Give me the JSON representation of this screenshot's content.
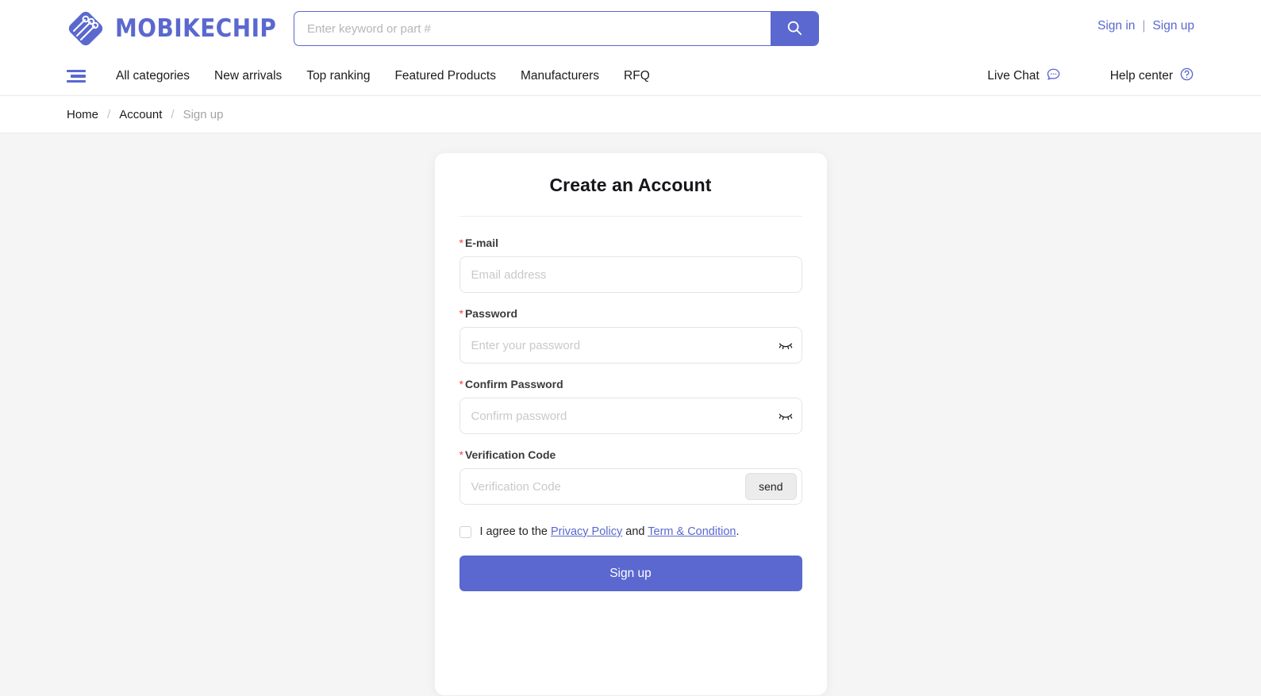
{
  "header": {
    "brand_name": "MOBIKECHIP",
    "brand_icon": "circuit-chip-logo-icon",
    "brand_color": "#5a68cf",
    "search": {
      "placeholder": "Enter keyword or part #",
      "value": "",
      "button_icon": "search-icon"
    },
    "account": {
      "sign_in": "Sign in",
      "separator": "|",
      "sign_up": "Sign up"
    }
  },
  "nav": {
    "menu_icon": "hamburger-menu-icon",
    "links": [
      {
        "label": "All categories"
      },
      {
        "label": "New arrivals"
      },
      {
        "label": "Top ranking"
      },
      {
        "label": "Featured Products"
      },
      {
        "label": "Manufacturers"
      },
      {
        "label": "RFQ"
      }
    ],
    "live_chat": {
      "label": "Live Chat",
      "icon": "chat-bubble-icon"
    },
    "help_center": {
      "label": "Help center",
      "icon": "question-circle-icon"
    }
  },
  "breadcrumb": {
    "home": "Home",
    "sep1": "/",
    "account": "Account",
    "sep2": "/",
    "current": "Sign up"
  },
  "card": {
    "title": "Create an Account",
    "fields": {
      "email": {
        "required_mark": "*",
        "label": "E-mail",
        "placeholder": "Email address",
        "value": ""
      },
      "password": {
        "required_mark": "*",
        "label": "Password",
        "placeholder": "Enter your password",
        "value": "",
        "toggle_icon": "eye-closed-icon"
      },
      "confirm_password": {
        "required_mark": "*",
        "label": "Confirm Password",
        "placeholder": "Confirm password",
        "value": "",
        "toggle_icon": "eye-closed-icon"
      },
      "verification_code": {
        "required_mark": "*",
        "label": "Verification Code",
        "placeholder": "Verification Code",
        "value": "",
        "send_label": "send"
      }
    },
    "agreement": {
      "checked": false,
      "text_before": "I agree to the",
      "privacy_policy": "Privacy Policy",
      "conjunction": "and",
      "terms": "Term & Condition",
      "period": "."
    },
    "submit_label": "Sign up"
  },
  "colors": {
    "accent": "#5a68cf",
    "page_background": "#f5f5f6",
    "required_red": "#f5414f",
    "muted_text": "#a3a3a3"
  }
}
